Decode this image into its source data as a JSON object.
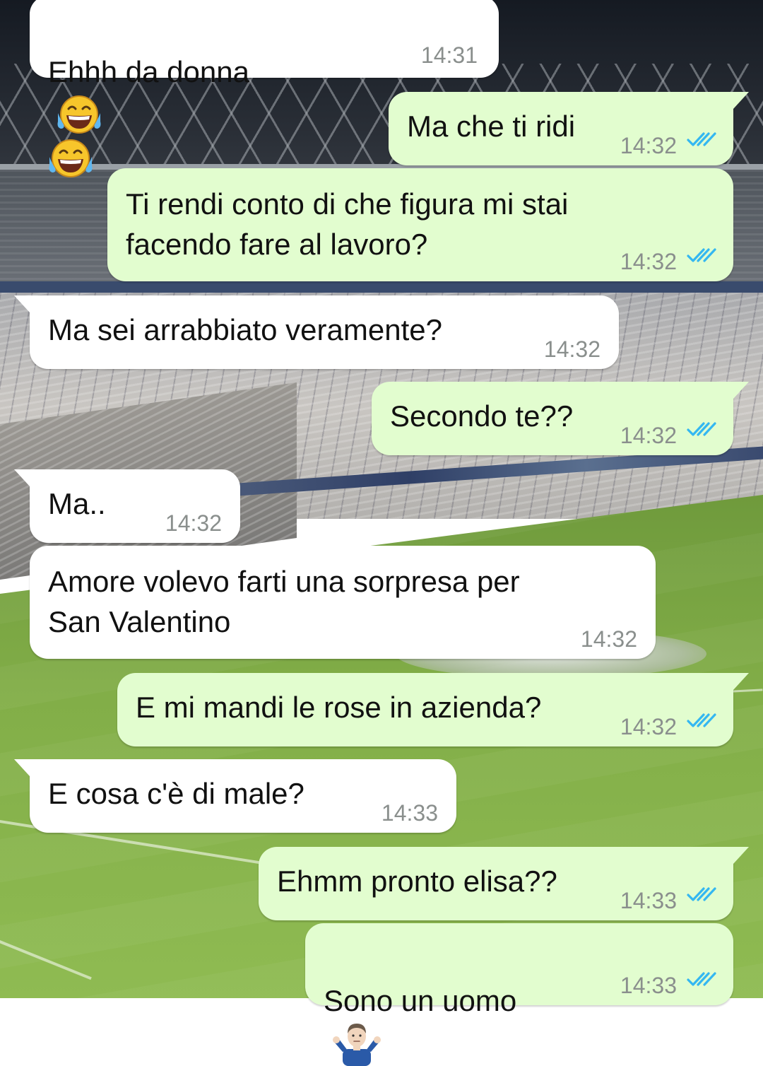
{
  "colors": {
    "incoming_bubble": "#ffffff",
    "outgoing_bubble": "#e2fdcf",
    "timestamp": "#8a8f8d",
    "read_ticks": "#34b7f1"
  },
  "messages": [
    {
      "direction": "in",
      "text": "Ehhh da donna",
      "emoji": [
        "face-with-tears-of-joy-icon",
        "face-with-tears-of-joy-icon"
      ],
      "time": "14:31"
    },
    {
      "direction": "out",
      "text": "Ma che ti ridi",
      "time": "14:32",
      "status": "read-double-check-icon"
    },
    {
      "direction": "out",
      "text": "Ti rendi conto di che figura mi stai\nfacendo fare al lavoro?",
      "time": "14:32",
      "status": "read-double-check-icon"
    },
    {
      "direction": "in",
      "text": "Ma sei arrabbiato veramente?",
      "time": "14:32"
    },
    {
      "direction": "out",
      "text": "Secondo te??",
      "time": "14:32",
      "status": "read-double-check-icon"
    },
    {
      "direction": "in",
      "text": "Ma..",
      "time": "14:32"
    },
    {
      "direction": "in",
      "text": "Amore volevo farti una sorpresa per\nSan Valentino",
      "time": "14:32"
    },
    {
      "direction": "out",
      "text": "E mi mandi le rose in azienda?",
      "time": "14:32",
      "status": "read-double-check-icon"
    },
    {
      "direction": "in",
      "text": "E cosa c'è di male?",
      "time": "14:33"
    },
    {
      "direction": "out",
      "text": "Ehmm pronto elisa??",
      "time": "14:33",
      "status": "read-double-check-icon"
    },
    {
      "direction": "out",
      "text": "Sono un uomo",
      "emoji": [
        "man-shrugging-icon"
      ],
      "time": "14:33",
      "status": "read-double-check-icon"
    }
  ]
}
